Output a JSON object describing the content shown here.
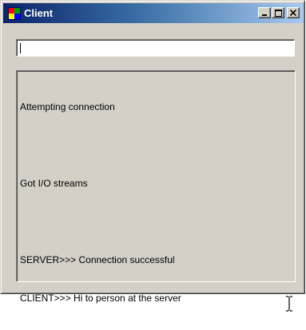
{
  "window": {
    "title": "Client",
    "controls": [
      "minimize",
      "maximize",
      "close"
    ]
  },
  "input": {
    "value": ""
  },
  "output": {
    "lines": [
      "Attempting connection",
      "",
      "Got I/O streams",
      "",
      "SERVER>>> Connection successful",
      "CLIENT>>> Hi to person at the server"
    ]
  },
  "icons": {
    "app": "app-icon",
    "minimize": "minimize-icon",
    "maximize": "maximize-icon",
    "close": "close-icon",
    "cursor": "ibeam-cursor-icon"
  }
}
